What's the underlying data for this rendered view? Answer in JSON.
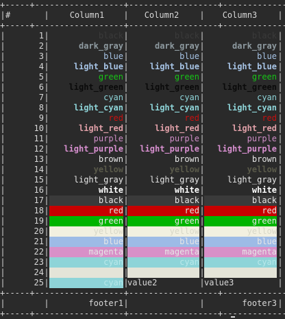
{
  "header": {
    "hash": "#",
    "col1": "Column1",
    "col2": "Column2",
    "col3": "Column3"
  },
  "separator": "+-----+------------------+------------------+------------------+",
  "rows": [
    {
      "n": "1",
      "c1": "black",
      "c2": "black",
      "c3": "black",
      "fg": "#3a3a3a",
      "bg": "",
      "bold": false
    },
    {
      "n": "2",
      "c1": "dark_gray",
      "c2": "dark_gray",
      "c3": "dark_gray",
      "fg": "#8e9aa0",
      "bg": "",
      "bold": true
    },
    {
      "n": "3",
      "c1": "blue",
      "c2": "blue",
      "c3": "blue",
      "fg": "#a7c4e6",
      "bg": "",
      "bold": false
    },
    {
      "n": "4",
      "c1": "light_blue",
      "c2": "light_blue",
      "c3": "light_blue",
      "fg": "#a7c4e6",
      "bg": "",
      "bold": true
    },
    {
      "n": "5",
      "c1": "green",
      "c2": "green",
      "c3": "green",
      "fg": "#17c417",
      "bg": "",
      "bold": false
    },
    {
      "n": "6",
      "c1": "light_green",
      "c2": "light_green",
      "c3": "light_green",
      "fg": "#0a0a0a",
      "bg": "",
      "bold": true
    },
    {
      "n": "7",
      "c1": "cyan",
      "c2": "cyan",
      "c3": "cyan",
      "fg": "#8ed4d8",
      "bg": "",
      "bold": false
    },
    {
      "n": "8",
      "c1": "light_cyan",
      "c2": "light_cyan",
      "c3": "light_cyan",
      "fg": "#8ed4d8",
      "bg": "",
      "bold": true
    },
    {
      "n": "9",
      "c1": "red",
      "c2": "red",
      "c3": "red",
      "fg": "#c81010",
      "bg": "",
      "bold": false
    },
    {
      "n": "10",
      "c1": "light_red",
      "c2": "light_red",
      "c3": "light_red",
      "fg": "#e0a0a8",
      "bg": "",
      "bold": true
    },
    {
      "n": "11",
      "c1": "purple",
      "c2": "purple",
      "c3": "purple",
      "fg": "#d08ec8",
      "bg": "",
      "bold": false
    },
    {
      "n": "12",
      "c1": "light_purple",
      "c2": "light_purple",
      "c3": "light_purple",
      "fg": "#d890d0",
      "bg": "",
      "bold": true
    },
    {
      "n": "13",
      "c1": "brown",
      "c2": "brown",
      "c3": "brown",
      "fg": "#e6e6e6",
      "bg": "",
      "bold": false
    },
    {
      "n": "14",
      "c1": "yellow",
      "c2": "yellow",
      "c3": "yellow",
      "fg": "#5a5a4a",
      "bg": "",
      "bold": true
    },
    {
      "n": "15",
      "c1": "light_gray",
      "c2": "light_gray",
      "c3": "light_gray",
      "fg": "#e6e6e6",
      "bg": "",
      "bold": false
    },
    {
      "n": "16",
      "c1": "white",
      "c2": "white",
      "c3": "white",
      "fg": "#ffffff",
      "bg": "",
      "bold": true
    },
    {
      "n": "17",
      "c1": "black",
      "c2": "black",
      "c3": "black",
      "fg": "#e6e6e6",
      "bg": "#3a3a3a",
      "bold": false
    },
    {
      "n": "18",
      "c1": "red",
      "c2": "red",
      "c3": "red",
      "fg": "#e6e6e6",
      "bg": "#c80000",
      "bold": false
    },
    {
      "n": "19",
      "c1": "green",
      "c2": "green",
      "c3": "green",
      "fg": "#e6e6e6",
      "bg": "#00b400",
      "bold": false
    },
    {
      "n": "20",
      "c1": "yellow",
      "c2": "yellow",
      "c3": "yellow",
      "fg": "#d8d8c8",
      "bg": "#f2f0e0",
      "bold": false
    },
    {
      "n": "21",
      "c1": "blue",
      "c2": "blue",
      "c3": "blue",
      "fg": "#e6e6e6",
      "bg": "#9dbbe6",
      "bold": false
    },
    {
      "n": "22",
      "c1": "magenta",
      "c2": "magenta",
      "c3": "magenta",
      "fg": "#e6e6e6",
      "bg": "#d890c8",
      "bold": false
    },
    {
      "n": "23",
      "c1": "cyan",
      "c2": "cyan",
      "c3": "cyan",
      "fg": "#b8e8ea",
      "bg": "#8ed4d8",
      "bold": false
    },
    {
      "n": "24",
      "c1": "",
      "c2": "",
      "c3": "",
      "fg": "#e6e6e6",
      "bg": "#e4e4d8",
      "bold": false
    },
    {
      "n": "25",
      "c1": "cyan",
      "c2": "value2",
      "c3": "value3",
      "fg": "#b8e8ea",
      "bg": "#8ed4d8",
      "bold": false,
      "c2plain": true
    }
  ],
  "footer": {
    "col1": "footer1",
    "col2": "",
    "col3": "footer3"
  }
}
